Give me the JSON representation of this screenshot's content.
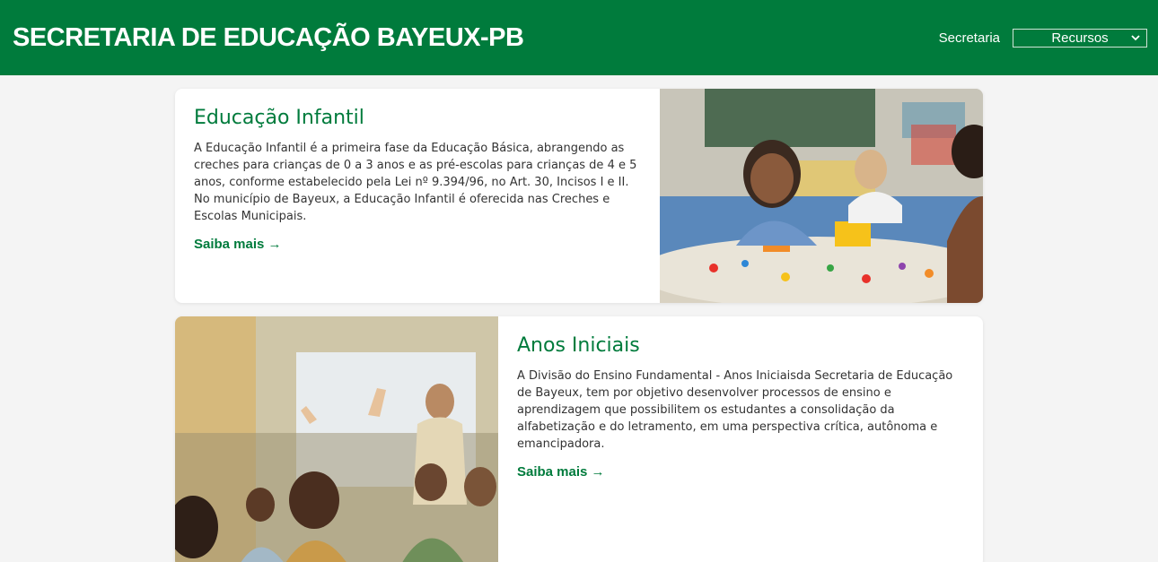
{
  "header": {
    "title": "SECRETARIA DE EDUCAÇÃO BAYEUX-PB",
    "nav_link": "Secretaria",
    "select_value": "Recursos"
  },
  "cards": [
    {
      "title": "Educação Infantil",
      "body": "A Educação Infantil é a primeira fase da Educação Básica, abrangendo as creches para crianças de 0 a 3 anos e as pré-escolas para crianças de 4 e 5 anos, conforme estabelecido pela Lei nº 9.394/96, no Art. 30, Incisos I e II. No município de Bayeux, a Educação Infantil é oferecida nas Creches e Escolas Municipais.",
      "link": "Saiba mais →"
    },
    {
      "title": "Anos Iniciais",
      "body": "A Divisão do Ensino Fundamental - Anos Iniciaisda Secretaria de Educação de Bayeux, tem por objetivo desenvolver processos de ensino e aprendizagem que possibilitem os estudantes a consolidação da alfabetização e do letramento, em uma perspectiva crítica, autônoma e emancipadora.",
      "link": "Saiba mais →"
    }
  ],
  "colors": {
    "brand_green": "#007b3c",
    "page_bg": "#f4f4f4"
  }
}
